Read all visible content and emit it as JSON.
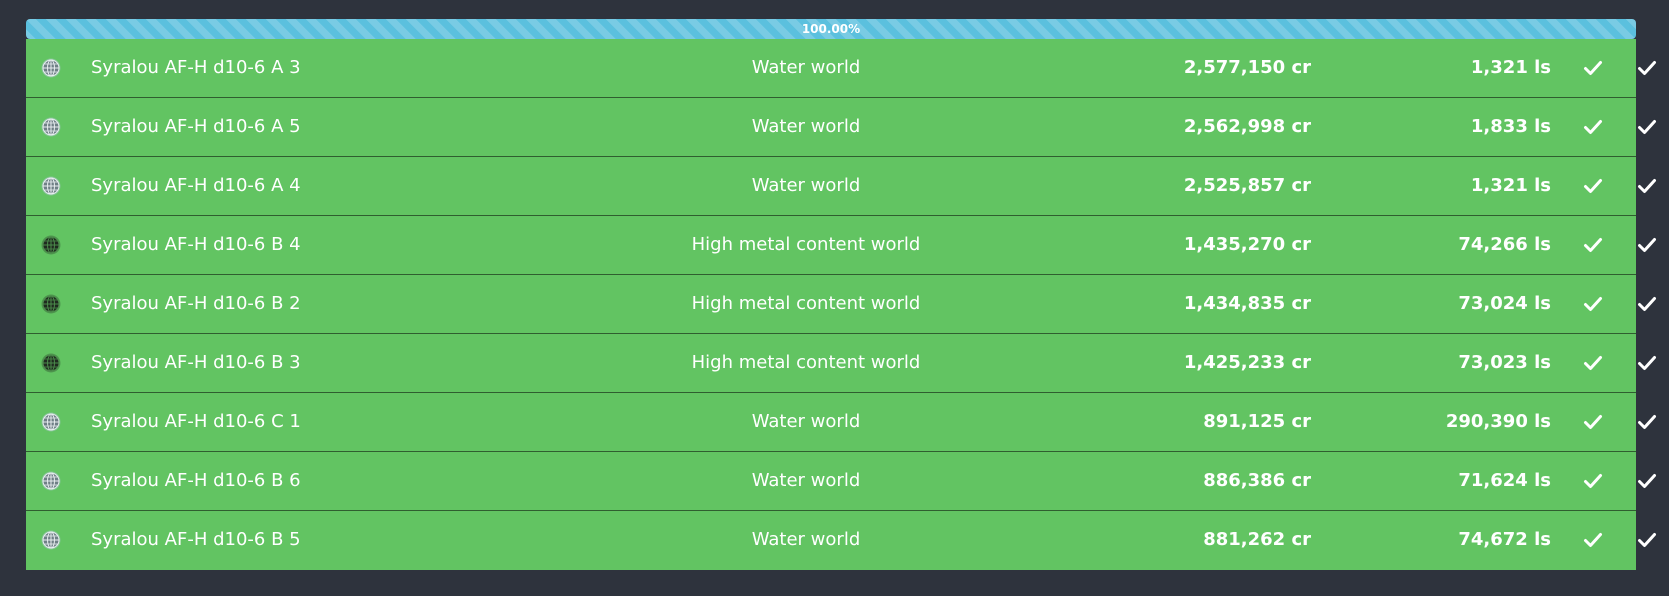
{
  "progress": {
    "label": "100.00%",
    "fraction": 1.0,
    "color": "#5bc0de"
  },
  "row_color": "#62c462",
  "rows": [
    {
      "icon": "water-world-icon",
      "name": "Syralou AF-H d10-6 A 3",
      "type": "Water world",
      "value": "2,577,150 cr",
      "distance": "1,321 ls",
      "mapped": "check-icon",
      "scanned": "check-icon"
    },
    {
      "icon": "water-world-icon",
      "name": "Syralou AF-H d10-6 A 5",
      "type": "Water world",
      "value": "2,562,998 cr",
      "distance": "1,833 ls",
      "mapped": "check-icon",
      "scanned": "check-icon"
    },
    {
      "icon": "water-world-icon",
      "name": "Syralou AF-H d10-6 A 4",
      "type": "Water world",
      "value": "2,525,857 cr",
      "distance": "1,321 ls",
      "mapped": "check-icon",
      "scanned": "check-icon"
    },
    {
      "icon": "high-metal-world-icon",
      "name": "Syralou AF-H d10-6 B 4",
      "type": "High metal content world",
      "value": "1,435,270 cr",
      "distance": "74,266 ls",
      "mapped": "check-icon",
      "scanned": "check-icon"
    },
    {
      "icon": "high-metal-world-icon",
      "name": "Syralou AF-H d10-6 B 2",
      "type": "High metal content world",
      "value": "1,434,835 cr",
      "distance": "73,024 ls",
      "mapped": "check-icon",
      "scanned": "check-icon"
    },
    {
      "icon": "high-metal-world-icon",
      "name": "Syralou AF-H d10-6 B 3",
      "type": "High metal content world",
      "value": "1,425,233 cr",
      "distance": "73,023 ls",
      "mapped": "check-icon",
      "scanned": "check-icon"
    },
    {
      "icon": "water-world-icon",
      "name": "Syralou AF-H d10-6 C 1",
      "type": "Water world",
      "value": "891,125 cr",
      "distance": "290,390 ls",
      "mapped": "check-icon",
      "scanned": "check-icon"
    },
    {
      "icon": "water-world-icon",
      "name": "Syralou AF-H d10-6 B 6",
      "type": "Water world",
      "value": "886,386 cr",
      "distance": "71,624 ls",
      "mapped": "check-icon",
      "scanned": "check-icon"
    },
    {
      "icon": "water-world-icon",
      "name": "Syralou AF-H d10-6 B 5",
      "type": "Water world",
      "value": "881,262 cr",
      "distance": "74,672 ls",
      "mapped": "check-icon",
      "scanned": "check-icon"
    }
  ]
}
